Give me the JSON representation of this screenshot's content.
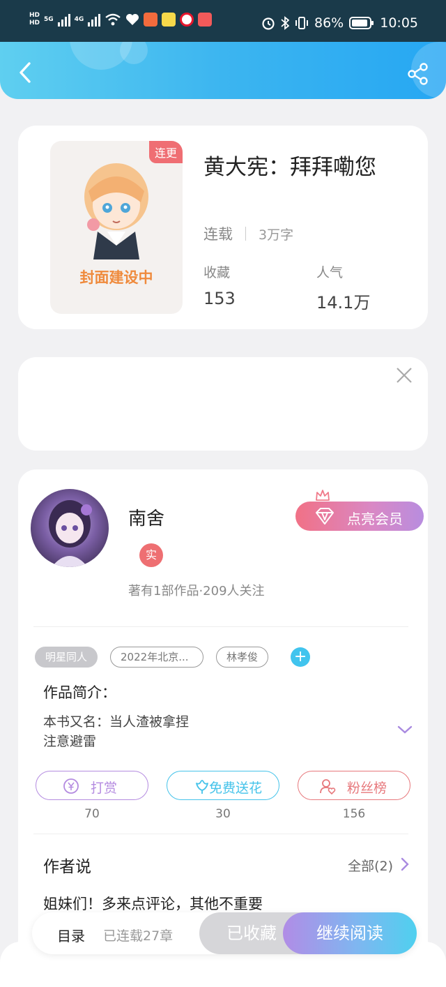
{
  "status_bar": {
    "hd1": "HD",
    "hd2": "HD",
    "sim1": "5G",
    "sim2": "4G",
    "battery": "86%",
    "time": "10:05"
  },
  "book": {
    "serial_tag": "连更",
    "cover_text": "封面建设中",
    "title": "黄大宪：拜拜嘞您",
    "status": "连载",
    "word_count": "3万字",
    "favorites_label": "收藏",
    "favorites_value": "153",
    "popularity_label": "人气",
    "popularity_value": "14.1万"
  },
  "author": {
    "name": "南舍",
    "verified_badge": "实",
    "stats": "著有1部作品·209人关注",
    "vip_button": "点亮会员"
  },
  "tags": [
    "明星同人",
    "2022年北京...",
    "林孝俊"
  ],
  "intro": {
    "heading": "作品简介：",
    "line1": "本书又名：当人渣被拿捏",
    "line2": "注意避雷"
  },
  "actions": [
    {
      "label": "打赏",
      "count": "70",
      "color": "#b48be0"
    },
    {
      "label": "免费送花",
      "count": "30",
      "color": "#45c3ea"
    },
    {
      "label": "粉丝榜",
      "count": "156",
      "color": "#e7787c"
    }
  ],
  "author_says": {
    "heading": "作者说",
    "all_link": "全部(2)",
    "text": "姐妹们！多来点评论，其他不重要"
  },
  "bottom_bar": {
    "toc": "目录",
    "chapters": "已连载27章",
    "collected": "已收藏",
    "continue": "继续阅读"
  }
}
